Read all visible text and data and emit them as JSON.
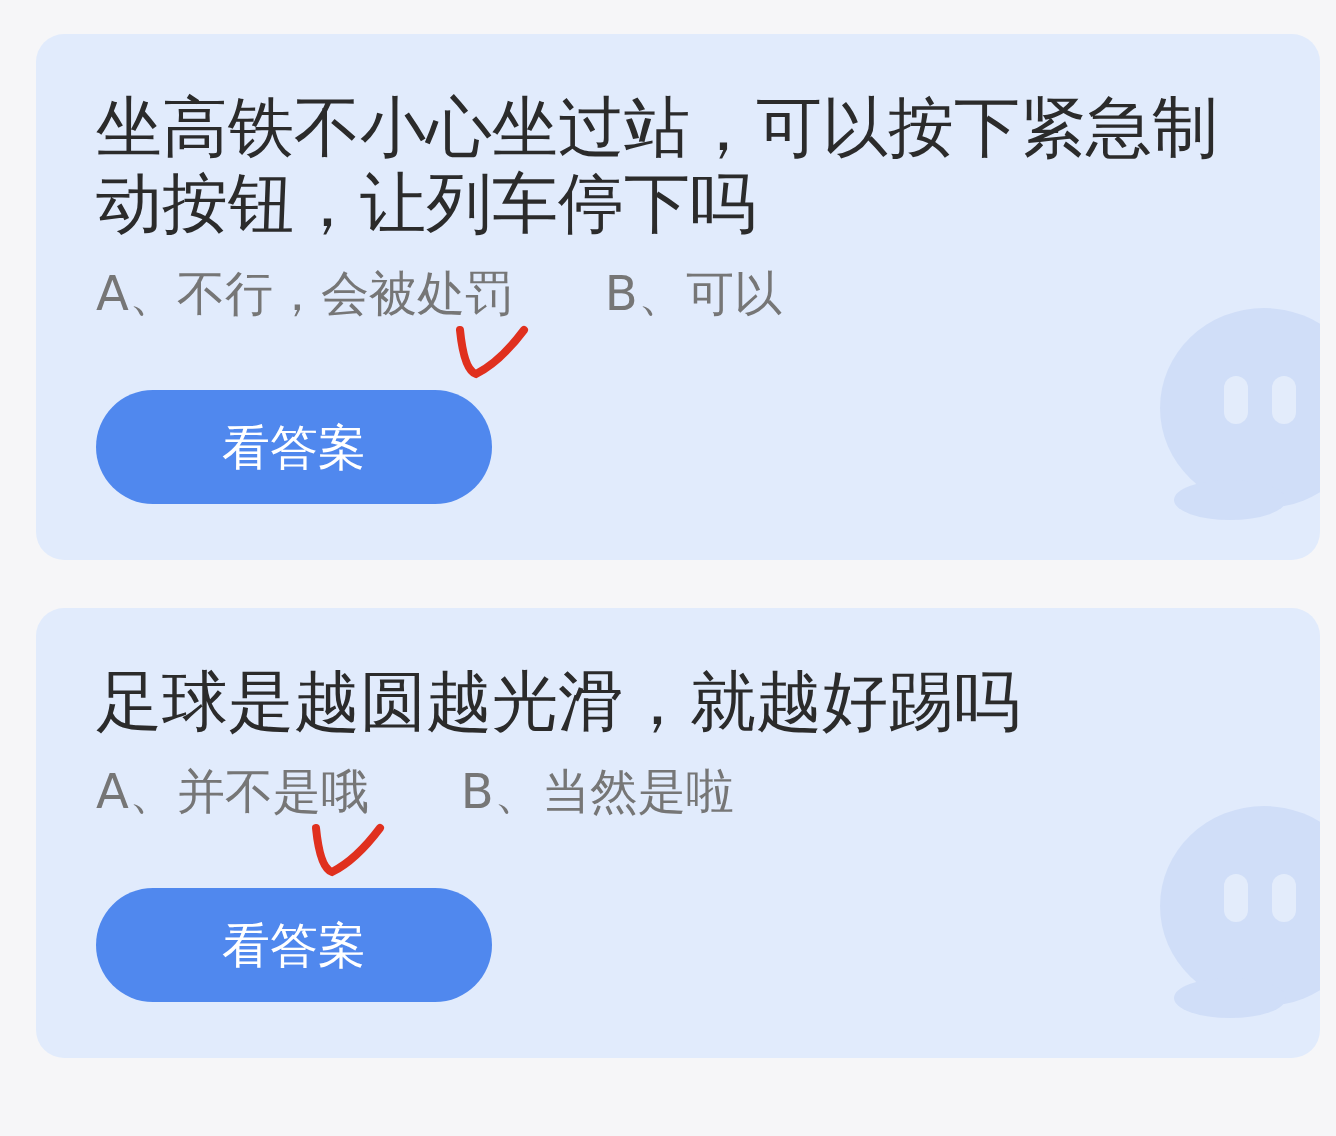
{
  "questions": [
    {
      "title": "坐高铁不小心坐过站，可以按下紧急制动按钮，让列车停下吗",
      "options": [
        {
          "text": "A、不行，会被处罚",
          "marked": true
        },
        {
          "text": "B、可以",
          "marked": false
        }
      ],
      "button": "看答案"
    },
    {
      "title": "足球是越圆越光滑，就越好踢吗",
      "options": [
        {
          "text": "A、并不是哦",
          "marked": true
        },
        {
          "text": "B、当然是啦",
          "marked": false
        }
      ],
      "button": "看答案"
    }
  ]
}
